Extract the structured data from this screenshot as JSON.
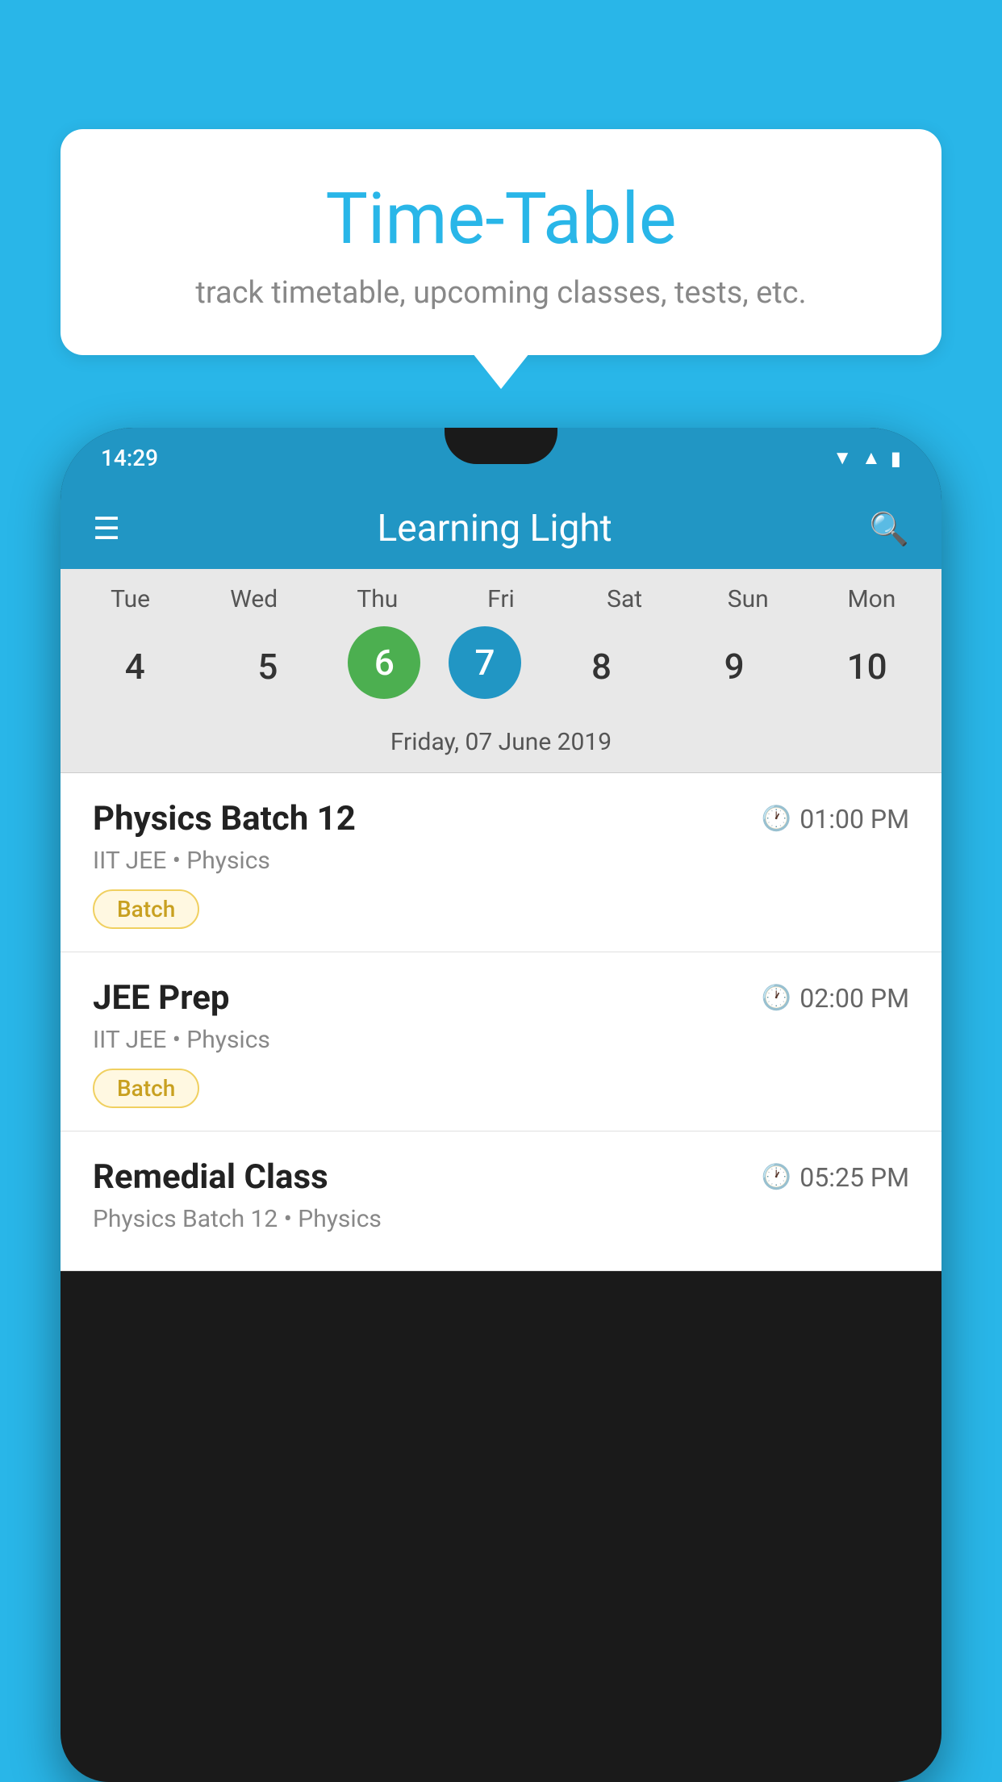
{
  "background_color": "#29b6e8",
  "bubble": {
    "title": "Time-Table",
    "subtitle": "track timetable, upcoming classes, tests, etc."
  },
  "phone": {
    "status_time": "14:29",
    "app_title": "Learning Light",
    "calendar": {
      "days": [
        "Tue",
        "Wed",
        "Thu",
        "Fri",
        "Sat",
        "Sun",
        "Mon"
      ],
      "dates": [
        "4",
        "5",
        "6",
        "7",
        "8",
        "9",
        "10"
      ],
      "today_index": 2,
      "selected_index": 3,
      "selected_label": "Friday, 07 June 2019"
    },
    "schedule": [
      {
        "name": "Physics Batch 12",
        "time": "01:00 PM",
        "subtitle": "IIT JEE • Physics",
        "badge": "Batch"
      },
      {
        "name": "JEE Prep",
        "time": "02:00 PM",
        "subtitle": "IIT JEE • Physics",
        "badge": "Batch"
      },
      {
        "name": "Remedial Class",
        "time": "05:25 PM",
        "subtitle": "Physics Batch 12 • Physics",
        "badge": ""
      }
    ]
  },
  "icons": {
    "hamburger": "≡",
    "search": "🔍",
    "clock": "⏱"
  }
}
